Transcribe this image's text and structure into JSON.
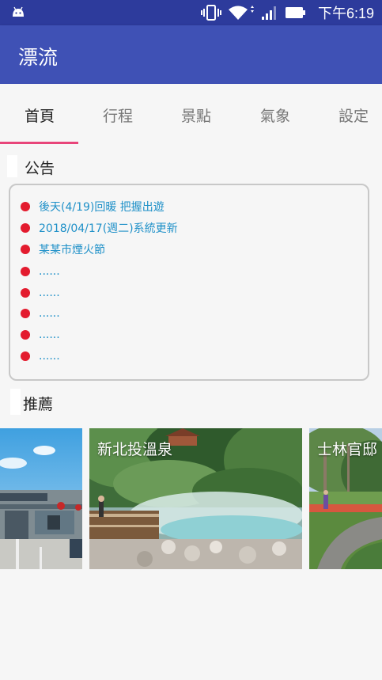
{
  "status_bar": {
    "time": "下午6:19"
  },
  "app_bar": {
    "title": "漂流"
  },
  "tabs": [
    {
      "label": "首頁",
      "active": true
    },
    {
      "label": "行程",
      "active": false
    },
    {
      "label": "景點",
      "active": false
    },
    {
      "label": "氣象",
      "active": false
    },
    {
      "label": "設定",
      "active": false
    }
  ],
  "announcements": {
    "title": "公告",
    "items": [
      "後天(4/19)回暖  把握出遊",
      "2018/04/17(週二)系統更新",
      "某某市煙火節",
      "......",
      "......",
      "......",
      "......",
      "......"
    ]
  },
  "recommend": {
    "title": "推薦",
    "cards": [
      {
        "label": ""
      },
      {
        "label": "新北投溫泉"
      },
      {
        "label": "士林官邸"
      }
    ]
  },
  "colors": {
    "status_bar": "#2d3b9c",
    "app_bar": "#3f51b5",
    "tab_indicator": "#e8457a",
    "bullet": "#e31b2e",
    "link_text": "#1e90c8"
  }
}
